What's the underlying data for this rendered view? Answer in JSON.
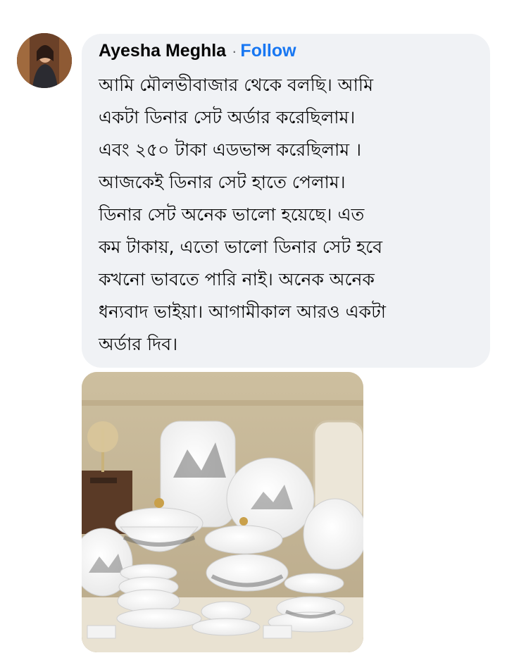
{
  "comment": {
    "author_name": "Ayesha Meghla",
    "separator": "·",
    "follow_label": "Follow",
    "lines": [
      "আমি মৌলভীবাজার থেকে বলছি। আমি",
      "একটা ডিনার সেট  অর্ডার করেছিলাম।",
      "এবং ২৫০ টাকা এডভান্স করেছিলাম ।",
      "আজকেই ডিনার সেট  হাতে পেলাম।",
      "ডিনার সেট  অনেক ভালো  হয়েছে। এত",
      "কম টাকায়, এতো ভালো ডিনার সেট  হবে",
      "কখনো ভাবতে পারি নাই। অনেক অনেক",
      "ধন্যবাদ ভাইয়া। আগামীকাল আরও একটা",
      "অর্ডার দিব।"
    ]
  },
  "attachment": {
    "icon": "photo-dinner-set"
  },
  "colors": {
    "bubble_bg": "#f0f2f5",
    "link": "#1877f2",
    "text": "#050505"
  }
}
